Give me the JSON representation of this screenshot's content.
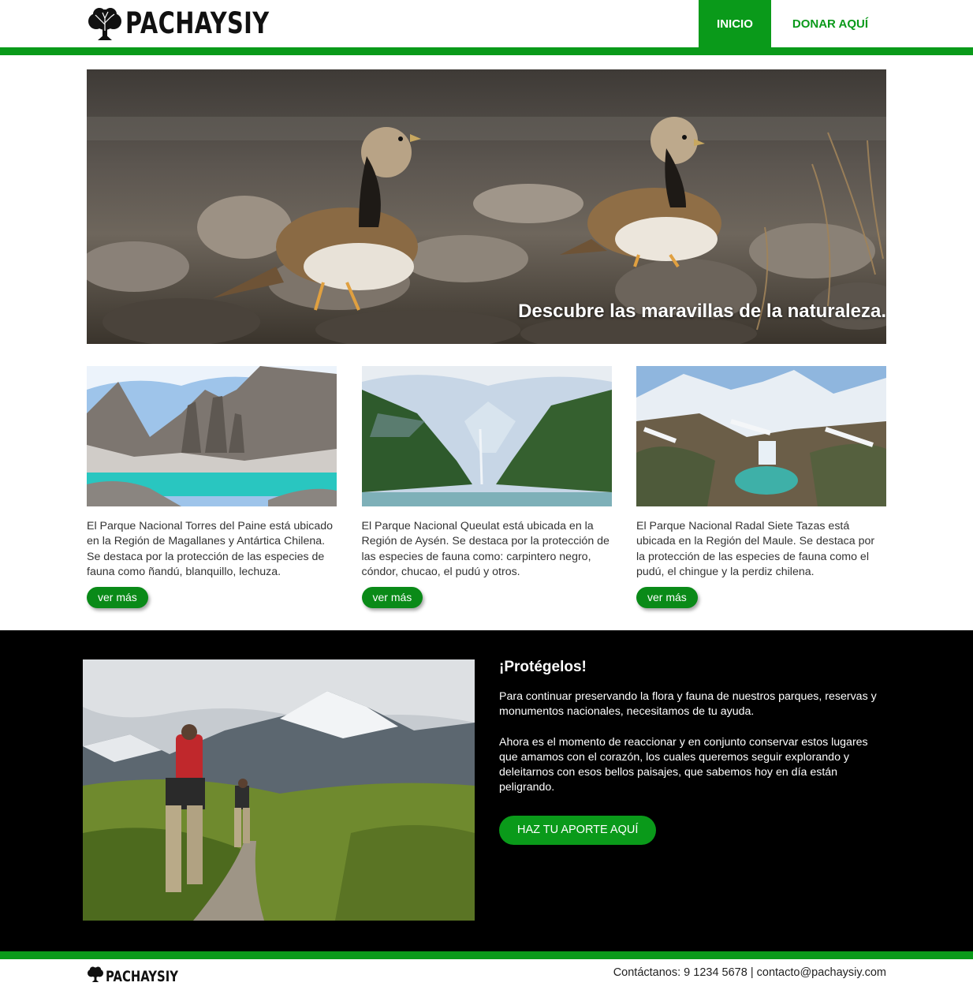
{
  "header": {
    "logo_text": "PACHAYSIY",
    "nav": [
      {
        "label": "INICIO",
        "active": true
      },
      {
        "label": "DONAR AQUÍ",
        "active": false
      }
    ]
  },
  "hero": {
    "caption": "Descubre las maravillas de la naturaleza."
  },
  "cards": [
    {
      "text": "El Parque Nacional Torres del Paine está ubicado en la Región de Magallanes y Antártica Chilena. Se destaca por la protección de las especies de fauna como ñandú, blanquillo, lechuza.",
      "button": "ver más"
    },
    {
      "text": "El Parque Nacional Queulat está ubicada en la Región de Aysén. Se destaca por la protección de las especies de fauna como: carpintero negro, cóndor, chucao, el pudú y otros.",
      "button": "ver más"
    },
    {
      "text": "El Parque Nacional Radal Siete Tazas está ubicada en la Región del Maule. Se destaca por la protección de las especies de fauna como el pudú, el chingue y la perdiz chilena.",
      "button": "ver más"
    }
  ],
  "protect": {
    "title": "¡Protégelos!",
    "paragraphs": [
      "Para continuar preservando la flora y fauna de nuestros parques, reservas y monumentos nacionales, necesitamos de tu ayuda.",
      "Ahora es el momento de reaccionar y en conjunto conservar estos lugares que amamos con el corazón, los cuales queremos seguir explorando y deleitarnos con esos bellos paisajes, que sabemos hoy en día están peligrando."
    ],
    "cta": "HAZ TU APORTE AQUÍ"
  },
  "footer": {
    "logo_text": "PACHAYSIY",
    "contact": "Contáctanos: 9 1234 5678 | contacto@pachaysiy.com"
  },
  "colors": {
    "brand_green": "#0a9a1a",
    "dark_section": "#000000"
  },
  "icons": [
    "tree-logo-icon"
  ]
}
